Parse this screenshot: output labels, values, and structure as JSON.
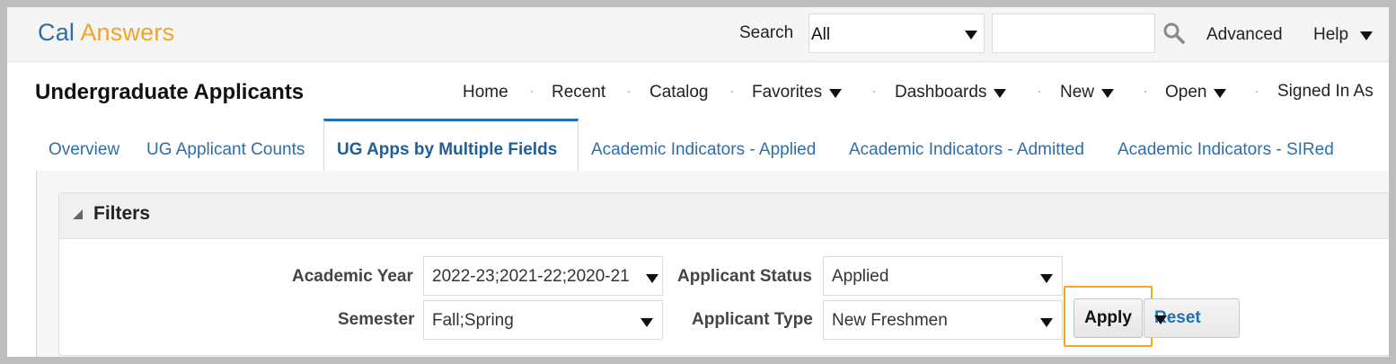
{
  "header": {
    "logo_part1": "Cal",
    "logo_part2": "Answers",
    "search_label": "Search",
    "search_scope": "All",
    "search_query": "",
    "advanced_label": "Advanced",
    "help_label": "Help"
  },
  "nav": {
    "page_title": "Undergraduate Applicants",
    "items": [
      {
        "label": "Home"
      },
      {
        "label": "Recent"
      },
      {
        "label": "Catalog"
      },
      {
        "label": "Favorites"
      },
      {
        "label": "Dashboards"
      },
      {
        "label": "New"
      },
      {
        "label": "Open"
      },
      {
        "label": "Signed In As"
      }
    ]
  },
  "tabs": [
    {
      "label": "Overview"
    },
    {
      "label": "UG Applicant Counts"
    },
    {
      "label": "UG Apps by Multiple Fields"
    },
    {
      "label": "Academic Indicators - Applied"
    },
    {
      "label": "Academic Indicators - Admitted"
    },
    {
      "label": "Academic Indicators - SIRed"
    }
  ],
  "filters": {
    "title": "Filters",
    "academic_year": {
      "label": "Academic Year",
      "value": "2022-23;2021-22;2020-21"
    },
    "semester": {
      "label": "Semester",
      "value": "Fall;Spring"
    },
    "applicant_status": {
      "label": "Applicant Status",
      "value": "Applied"
    },
    "applicant_type": {
      "label": "Applicant Type",
      "value": "New Freshmen"
    },
    "apply_label": "Apply",
    "reset_label": "Reset"
  },
  "colors": {
    "brand_blue": "#2f6ea7",
    "brand_gold": "#f0a623",
    "highlight": "#f2a91e"
  },
  "icons": [
    "search-icon",
    "dropdown-arrow-icon",
    "collapse-triangle-icon"
  ]
}
